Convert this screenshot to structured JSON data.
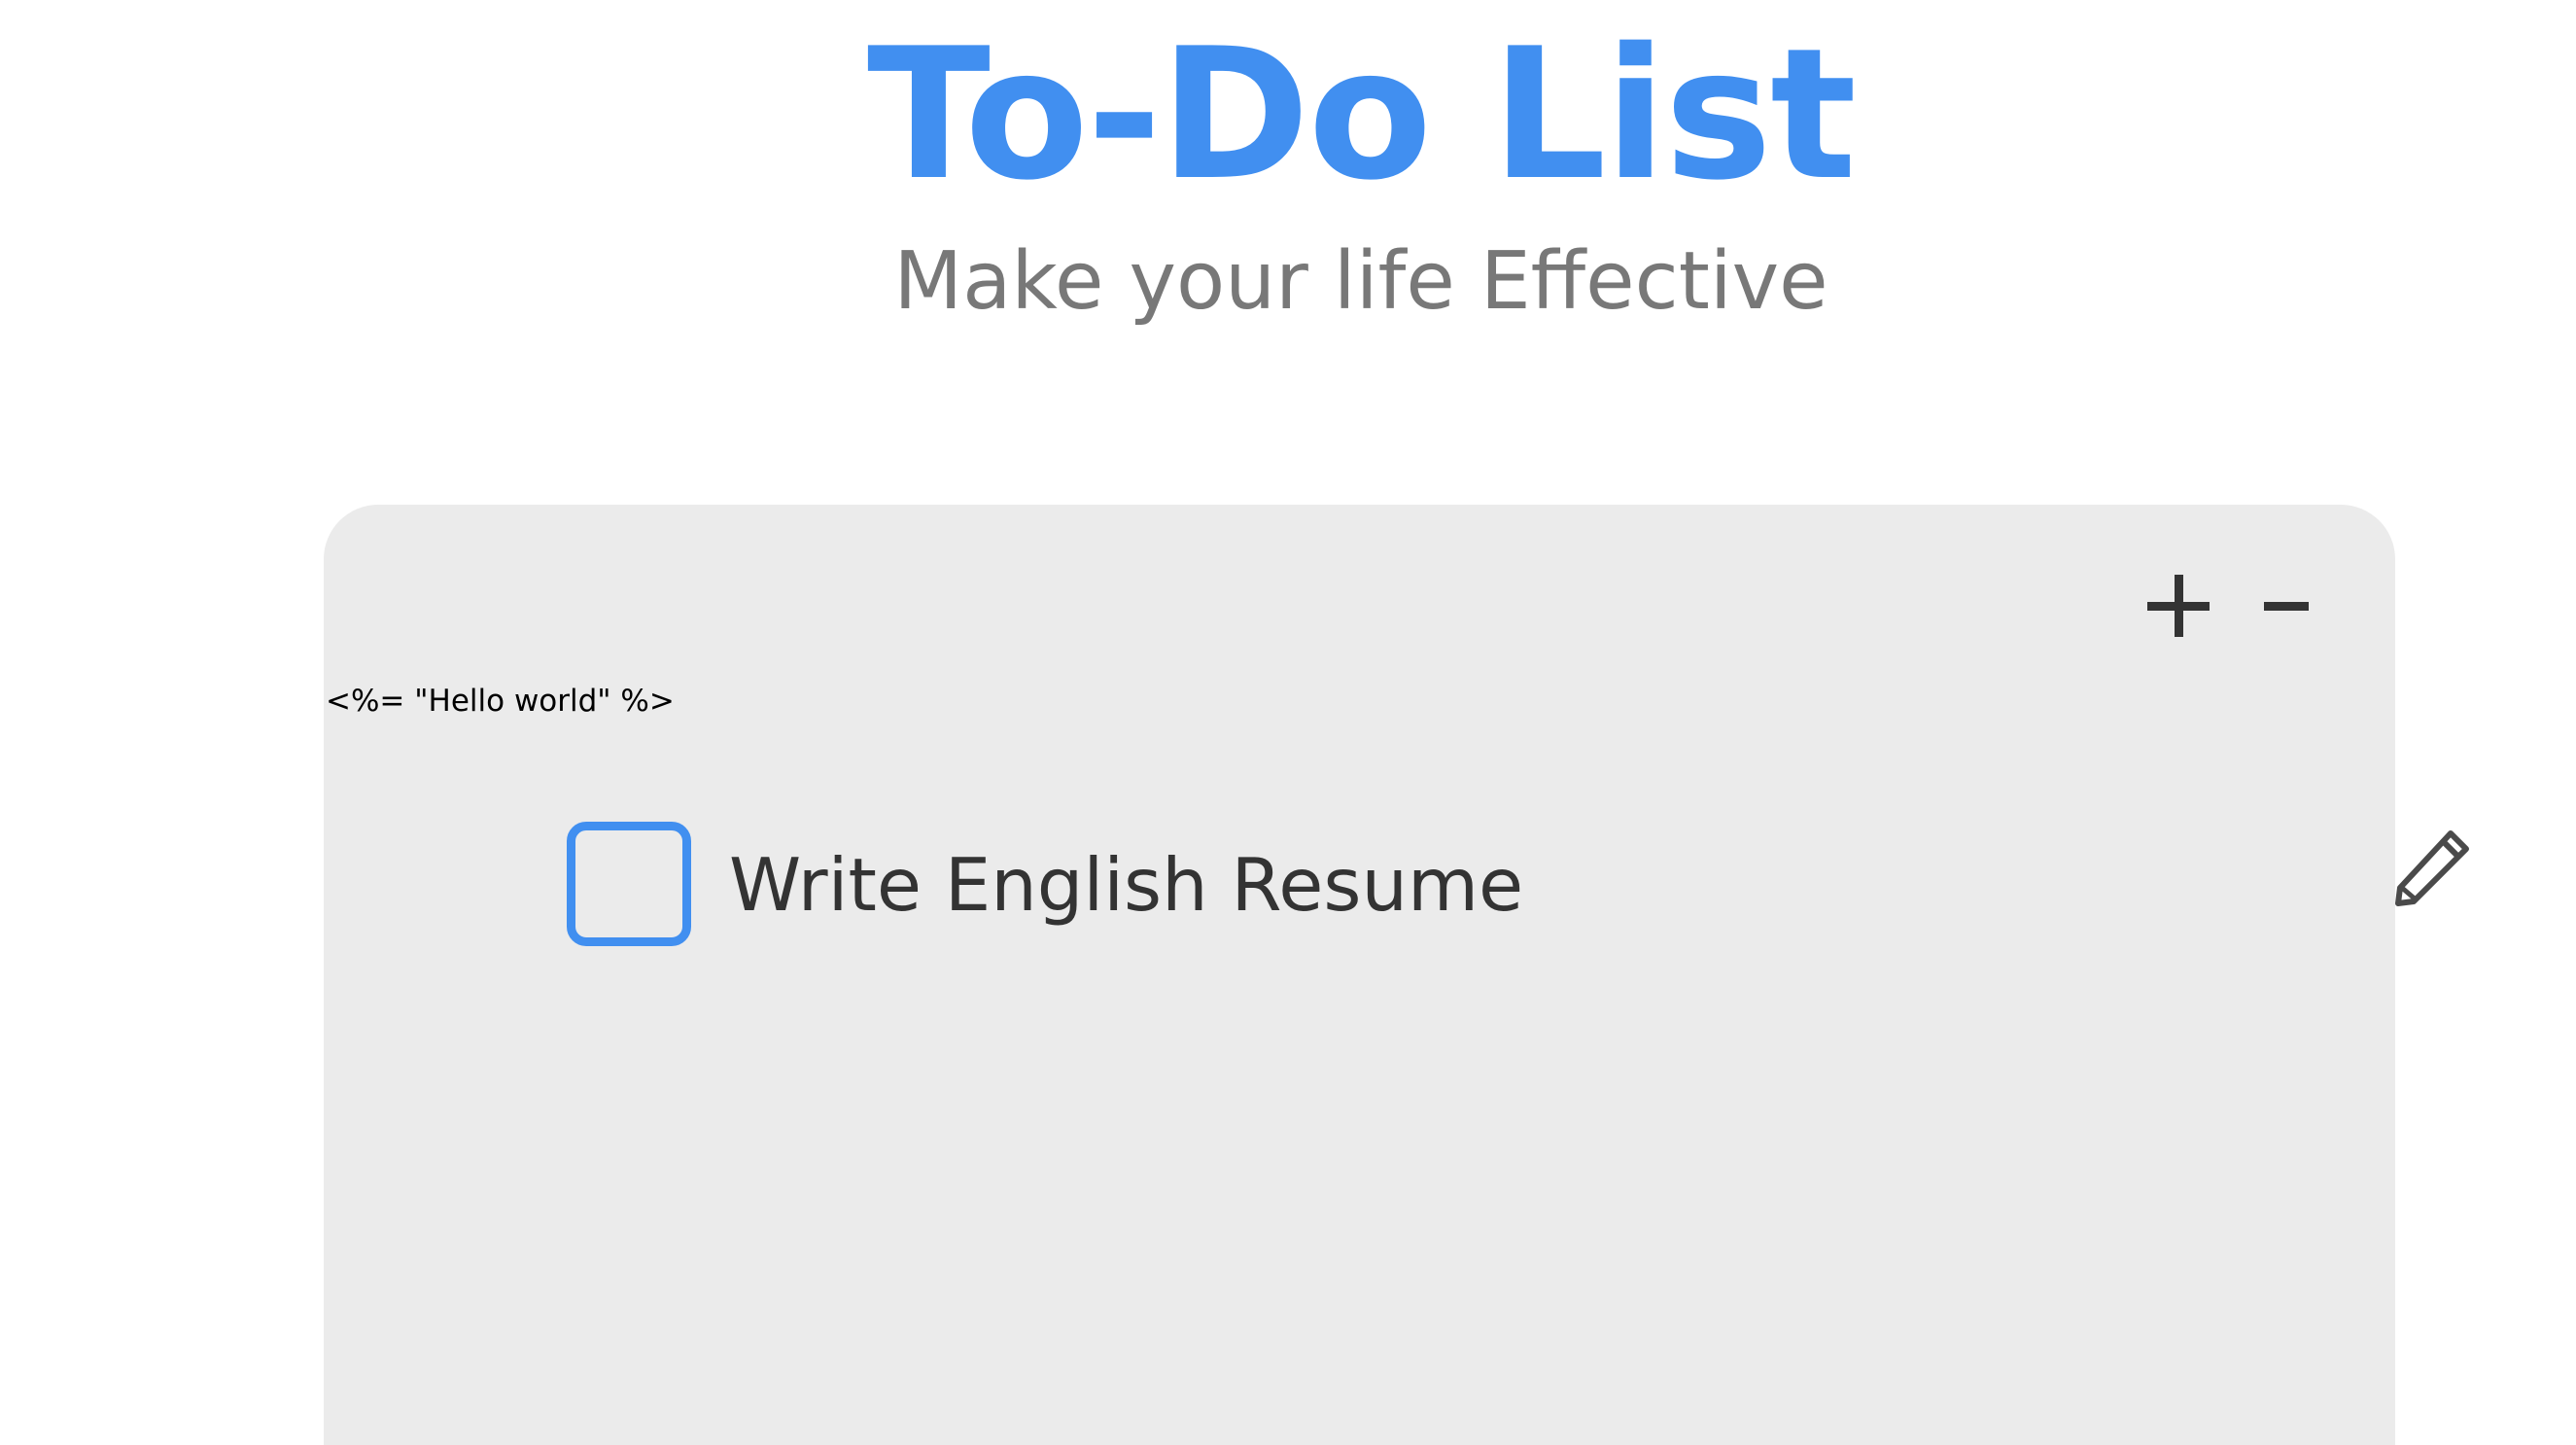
{
  "header": {
    "title": "To-Do List",
    "subtitle": "Make your life Effective"
  },
  "card": {
    "template_text": "<%= \"Hello world\" %>",
    "toolbar": {
      "add_icon": "plus-icon",
      "remove_icon": "minus-icon"
    },
    "items": [
      {
        "text": "Write English Resume",
        "checked": false,
        "edit_icon": "pencil-icon"
      }
    ]
  },
  "colors": {
    "accent": "#418ff0",
    "subtitle": "#787878",
    "card_background": "#ebebeb",
    "text_dark": "#333333"
  }
}
